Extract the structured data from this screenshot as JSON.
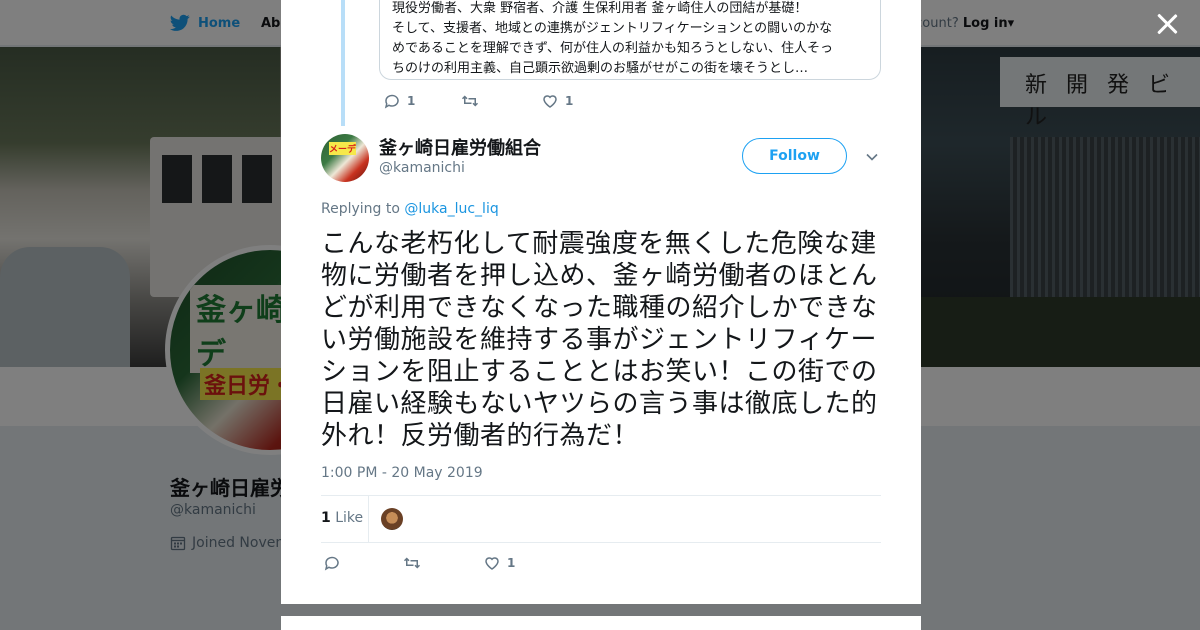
{
  "topbar": {
    "home_label": "Home",
    "about_label": "Abo",
    "account_prompt": "ccount?",
    "login_label": "Log in"
  },
  "banner": {
    "sign_text": "新 開 発 ビ ル"
  },
  "background_profile": {
    "avatar_text_top": "釜ヶ崎メーデ",
    "avatar_text_bottom": "釜日労・反",
    "name": "釜ヶ崎日雇労",
    "handle": "@kamanichi",
    "joined": "Joined Novem"
  },
  "parent_tweet": {
    "quoted_lines": [
      "現役労働者、大衆 野宿者、介護 生保利用者 釜ヶ崎住人の団結が基礎！",
      "そして、支援者、地域との連携がジェントリフィケーションとの闘いのかな",
      "めであることを理解できず、何が住人の利益かも知ろうとしない、住人そっ",
      "ちのけの利用主義、自己顕示欲過剰のお騒がせがこの街を壊そうとし…"
    ],
    "reply_count": "1",
    "retweet_count": "",
    "like_count": "1"
  },
  "tweet": {
    "author_name": "釜ヶ崎日雇労働組合",
    "author_handle": "@kamanichi",
    "avatar_text": "メーデ",
    "follow_label": "Follow",
    "replying_prefix": "Replying to",
    "replying_to": "@luka_luc_liq",
    "text": "こんな老朽化して耐震強度を無くした危険な建物に労働者を押し込め、釜ヶ崎労働者のほとんどが利用できなくなった職種の紹介しかできない労働施設を維持する事がジェントリフィケーションを阻止することとはお笑い！この街での日雇い経験もないヤツらの言う事は徹底した的外れ！反労働者的行為だ！",
    "timestamp": "1:00 PM - 20 May 2019",
    "likes_number": "1",
    "likes_label": "Like",
    "reply_count": "",
    "retweet_count": "",
    "like_count": "1"
  },
  "colors": {
    "accent": "#1da1f2",
    "link": "#1b95e0",
    "text_primary": "#14171a",
    "text_secondary": "#657786",
    "thread_line": "#b8def8"
  }
}
